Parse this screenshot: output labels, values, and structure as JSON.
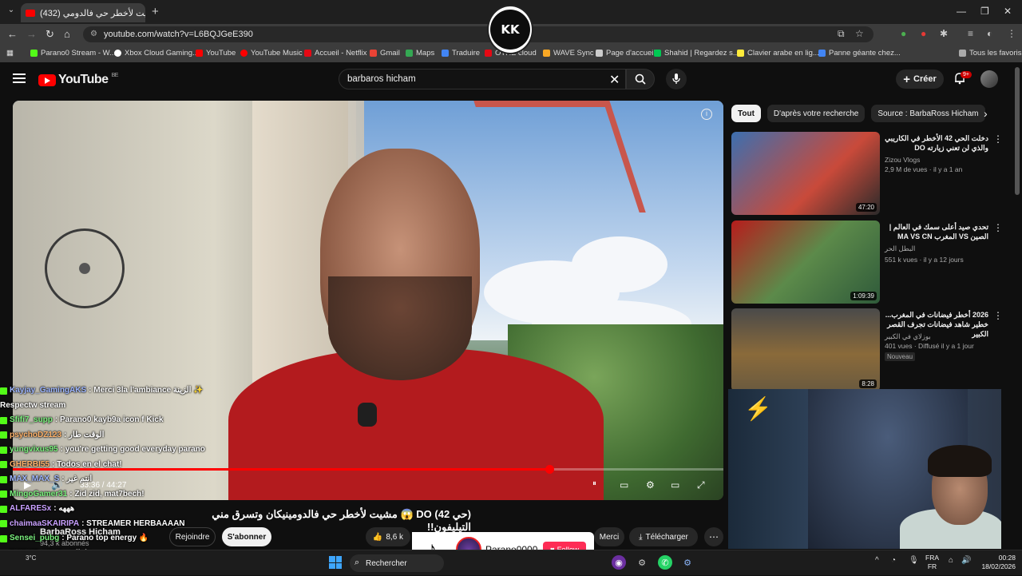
{
  "browser": {
    "tab_title": "(432) مشيت لأخطر حي فالدومي",
    "new_tab": "+",
    "url": "youtube.com/watch?v=L6BQJGeE390",
    "bookmarks": [
      {
        "label": "Parano0 Stream - W...",
        "color": "#53fc18"
      },
      {
        "label": "Xbox Cloud Gaming...",
        "color": "#ffffff"
      },
      {
        "label": "YouTube",
        "color": "#ff0000"
      },
      {
        "label": "YouTube Music",
        "color": "#ff0000"
      },
      {
        "label": "Accueil - Netflix",
        "color": "#e50914"
      },
      {
        "label": "Gmail",
        "color": "#ea4335"
      },
      {
        "label": "Maps",
        "color": "#34a853"
      },
      {
        "label": "Traduire",
        "color": "#4285f4"
      },
      {
        "label": "OTHE cloud",
        "color": "#e50914"
      },
      {
        "label": "WAVE Sync",
        "color": "#f9a825"
      },
      {
        "label": "Page d'accueil",
        "color": "#cccccc"
      },
      {
        "label": "Shahid | Regardez s...",
        "color": "#00c853"
      },
      {
        "label": "Clavier arabe en lig...",
        "color": "#ffeb3b"
      },
      {
        "label": "Panne géante chez...",
        "color": "#4285f4"
      }
    ],
    "all_favorites": "Tous les favoris",
    "overlay_logo": "KK"
  },
  "youtube": {
    "region": "BE",
    "logo_text": "YouTube",
    "search_value": "barbaros hicham",
    "create_label": "Créer",
    "notif_count": "9+",
    "video": {
      "time": "33:36 / 44:27",
      "progress": 0.755,
      "title": "(حي 42) DO 😱 مشيت لأخطر حي فالدومينيكان وتسرق مني التيليفون!!",
      "channel": "BarbaRoss Hicham",
      "subs": "94,3 k abonnés",
      "join": "Rejoindre",
      "subscribe": "S'abonner",
      "likes": "8,6 k",
      "thanks": "Merci",
      "download": "Télécharger"
    },
    "chips": [
      "Tout",
      "D'après votre recherche",
      "Source : BarbaRoss Hicham"
    ],
    "recommendations": [
      {
        "title": "دخلت الحي 42 الأخطر في الكاريبي والذي لن تعني زيارته DO",
        "channel": "Zizou Vlogs",
        "meta": "2,9 M de vues · il y a 1 an",
        "duration": "47:20",
        "thumb": "#3c6fb0"
      },
      {
        "title": "تحدي صيد أعلى سمك في العالم | الصين VS المغرب MA VS CN",
        "channel": "البطل الحر",
        "meta": "551 k vues · il y a 12 jours",
        "duration": "1:09:39",
        "thumb": "#3a7d44"
      },
      {
        "title": "2026 أخطر فيضانات في المغرب... خطير شاهد فيضانات تجرف القصر الكبير",
        "channel": "بوزلاي في الكبير",
        "meta": "401 vues · Diffusé il y a 1 jour",
        "duration": "8:28",
        "badge": "Nouveau",
        "thumb": "#6a5a3f"
      }
    ]
  },
  "chat": [
    {
      "user": "Kayjay_GamingAKS",
      "msg": ": Merci 3la l'ambiance الزينة ✨",
      "cls": ""
    },
    {
      "user": "",
      "msg": "Respectw stream",
      "cls": ""
    },
    {
      "user": "Sfifi7_supp",
      "msg": ": Parano0 kayb9a icon f Kick",
      "cls": "g"
    },
    {
      "user": "psychoDZ123",
      "msg": ": الوقت طار",
      "cls": "o"
    },
    {
      "user": "yungvixus95",
      "msg": ": you're getting good everyday parano",
      "cls": "g"
    },
    {
      "user": "GHERBI55",
      "msg": ": Todos en el chat!",
      "cls": "o"
    },
    {
      "user": "MAX_MAX_S",
      "msg": ": انتم غير",
      "cls": ""
    },
    {
      "user": "MingoGamer31",
      "msg": ": Zid zid, mat7bech!",
      "cls": "g"
    },
    {
      "user": "ALFARESx",
      "msg": ": هههه",
      "cls": "p"
    },
    {
      "user": "chaimaaSKAIRIPA",
      "msg": ": STREAMER HERBAAAAN",
      "cls": "p"
    },
    {
      "user": "Sensei_pubg",
      "msg": ": Parano top energy 🔥",
      "cls": "g"
    },
    {
      "user": "ROBOT_KING",
      "msg": ": Rijale",
      "cls": "g"
    },
    {
      "user": "BizaDZ",
      "msg": "",
      "cls": "p"
    }
  ],
  "tiktok": {
    "name": "Parano0000",
    "follow": "Follow"
  },
  "taskbar": {
    "search": "Rechercher",
    "weather": "3°C",
    "lang_top": "FRA",
    "lang_bottom": "FR",
    "time": "00:28",
    "date": "18/02/2026"
  }
}
